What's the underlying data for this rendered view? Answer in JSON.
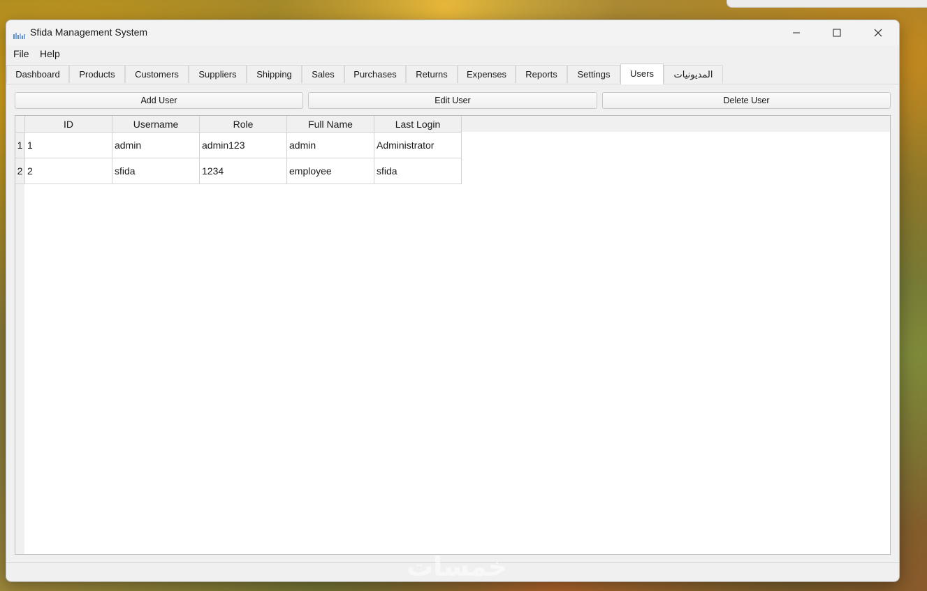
{
  "window": {
    "title": "Sfida Management System"
  },
  "menu": [
    "File",
    "Help"
  ],
  "tabs": [
    {
      "label": "Dashboard"
    },
    {
      "label": "Products"
    },
    {
      "label": "Customers"
    },
    {
      "label": "Suppliers"
    },
    {
      "label": "Shipping"
    },
    {
      "label": "Sales"
    },
    {
      "label": "Purchases"
    },
    {
      "label": "Returns"
    },
    {
      "label": "Expenses"
    },
    {
      "label": "Reports"
    },
    {
      "label": "Settings"
    },
    {
      "label": "Users"
    },
    {
      "label": "المديونيات"
    }
  ],
  "active_tab": "Users",
  "toolbar": {
    "add_label": "Add User",
    "edit_label": "Edit User",
    "delete_label": "Delete User"
  },
  "table": {
    "columns": [
      "ID",
      "Username",
      "Role",
      "Full Name",
      "Last Login"
    ],
    "rows": [
      {
        "num": "1",
        "cells": [
          "1",
          "admin",
          "admin123",
          "admin",
          "Administrator"
        ]
      },
      {
        "num": "2",
        "cells": [
          "2",
          "sfida",
          "1234",
          "employee",
          "sfida"
        ]
      }
    ]
  },
  "watermark": "خمسات"
}
